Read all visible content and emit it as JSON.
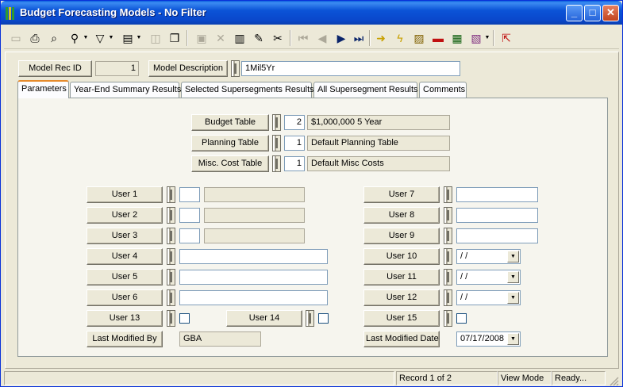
{
  "window": {
    "title": "Budget Forecasting Models - No Filter",
    "minimize_label": "_",
    "maximize_label": "□",
    "close_label": "✕"
  },
  "toolbar": {
    "tools": [
      {
        "name": "new-record",
        "glyph": "▭",
        "disabled": true
      },
      {
        "name": "print",
        "glyph": "⎙",
        "disabled": false
      },
      {
        "name": "print-preview",
        "glyph": "⌕",
        "disabled": false
      },
      {
        "name": "binoculars",
        "glyph": "⚲",
        "disabled": false
      },
      {
        "name": "filter",
        "glyph": "▽",
        "disabled": false
      },
      {
        "name": "report",
        "glyph": "▤",
        "disabled": false
      },
      {
        "name": "properties",
        "glyph": "◫",
        "disabled": true
      },
      {
        "name": "copy-record",
        "glyph": "❐",
        "disabled": false
      },
      {
        "name": "save",
        "glyph": "▣",
        "disabled": true
      },
      {
        "name": "delete",
        "glyph": "✕",
        "disabled": true
      },
      {
        "name": "books",
        "glyph": "▥",
        "disabled": false
      },
      {
        "name": "edit-pencil",
        "glyph": "✎",
        "disabled": false
      },
      {
        "name": "cut",
        "glyph": "✂",
        "disabled": false
      },
      {
        "name": "first-record",
        "glyph": "⏮",
        "disabled": true
      },
      {
        "name": "previous-record",
        "glyph": "◀",
        "disabled": true
      },
      {
        "name": "next-record",
        "glyph": "▶",
        "disabled": false
      },
      {
        "name": "last-record",
        "glyph": "⏭",
        "disabled": false
      },
      {
        "name": "go-arrow",
        "glyph": "➜",
        "disabled": false
      },
      {
        "name": "lightning",
        "glyph": "ϟ",
        "disabled": false
      },
      {
        "name": "image-frame",
        "glyph": "▨",
        "disabled": false
      },
      {
        "name": "red-folder",
        "glyph": "▬",
        "disabled": false
      },
      {
        "name": "grid",
        "glyph": "▦",
        "disabled": false
      },
      {
        "name": "book-stack",
        "glyph": "▧",
        "disabled": false
      },
      {
        "name": "exit",
        "glyph": "⇱",
        "disabled": false
      }
    ]
  },
  "header": {
    "rec_id_label": "Model Rec ID",
    "rec_id_value": "1",
    "description_label": "Model Description",
    "description_value": "1Mil5Yr"
  },
  "tabs": [
    {
      "label": "Parameters",
      "active": true
    },
    {
      "label": "Year-End Summary Results",
      "active": false
    },
    {
      "label": "Selected Supersegments Results",
      "active": false
    },
    {
      "label": "All Supersegment Results",
      "active": false
    },
    {
      "label": "Comments",
      "active": false
    }
  ],
  "tables": {
    "budget_label": "Budget Table",
    "budget_num": "2",
    "budget_desc": "$1,000,000 5 Year",
    "planning_label": "Planning Table",
    "planning_num": "1",
    "planning_desc": "Default Planning Table",
    "misc_label": "Misc. Cost Table",
    "misc_num": "1",
    "misc_desc": "Default Misc Costs"
  },
  "users": {
    "user1": "User 1",
    "user2": "User 2",
    "user3": "User 3",
    "user4": "User 4",
    "user5": "User 5",
    "user6": "User 6",
    "user7": "User 7",
    "user8": "User 8",
    "user9": "User 9",
    "user10": "User 10",
    "user10_value": " / /",
    "user11": "User 11",
    "user11_value": " / /",
    "user12": "User 12",
    "user12_value": " / /",
    "user13": "User 13",
    "user14": "User 14",
    "user15": "User 15",
    "last_modified_by_label": "Last Modified By",
    "last_modified_by_value": "GBA",
    "last_modified_date_label": "Last Modified Date",
    "last_modified_date_value": "07/17/2008"
  },
  "status": {
    "record": "Record 1 of 2",
    "mode": "View Mode",
    "ready": "Ready..."
  },
  "colors": {
    "titlebar": "#0a48cc",
    "window_bg": "#ece9d8",
    "tab_highlight": "#e68b2c"
  }
}
